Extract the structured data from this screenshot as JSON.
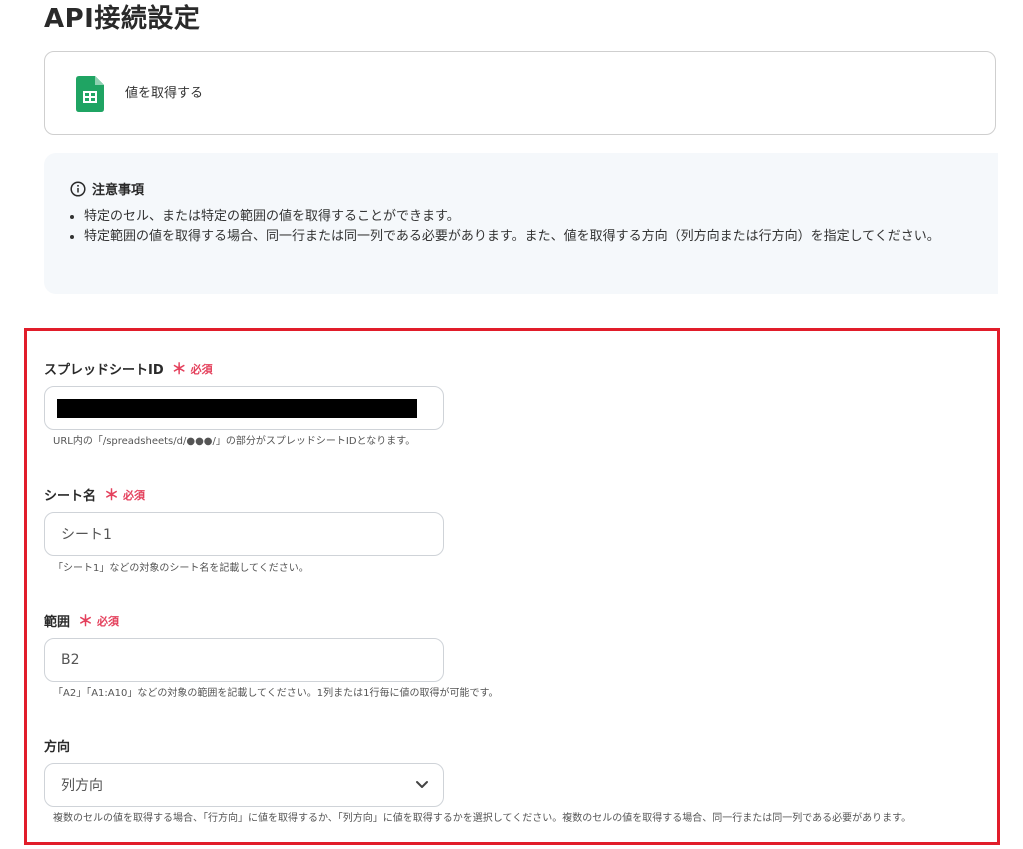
{
  "page": {
    "title": "API接続設定"
  },
  "action": {
    "label": "値を取得する",
    "icon": "google-sheets-icon"
  },
  "notice": {
    "heading": "注意事項",
    "items": [
      "特定のセル、または特定の範囲の値を取得することができます。",
      "特定範囲の値を取得する場合、同一行または同一列である必要があります。また、値を取得する方向（列方向または行方向）を指定してください。"
    ]
  },
  "fields": {
    "spreadsheet_id": {
      "label": "スプレッドシートID",
      "required_mark": "＊",
      "required_text": "必須",
      "help": "URL内の「/spreadsheets/d/●●●/」の部分がスプレッドシートIDとなります。"
    },
    "sheet_name": {
      "label": "シート名",
      "required_mark": "＊",
      "required_text": "必須",
      "value": "シート1",
      "help": "「シート1」などの対象のシート名を記載してください。"
    },
    "range": {
      "label": "範囲",
      "required_mark": "＊",
      "required_text": "必須",
      "value": "B2",
      "help": "「A2」「A1:A10」などの対象の範囲を記載してください。1列または1行毎に値の取得が可能です。"
    },
    "direction": {
      "label": "方向",
      "value": "列方向",
      "help": "複数のセルの値を取得する場合、「行方向」に値を取得するか、「列方向」に値を取得するかを選択してください。複数のセルの値を取得する場合、同一行または同一列である必要があります。"
    }
  },
  "colors": {
    "required": "#e4405c",
    "highlight_border": "#e11d2a",
    "sheets_green": "#1fa463",
    "notice_bg": "#f5f8fb"
  }
}
